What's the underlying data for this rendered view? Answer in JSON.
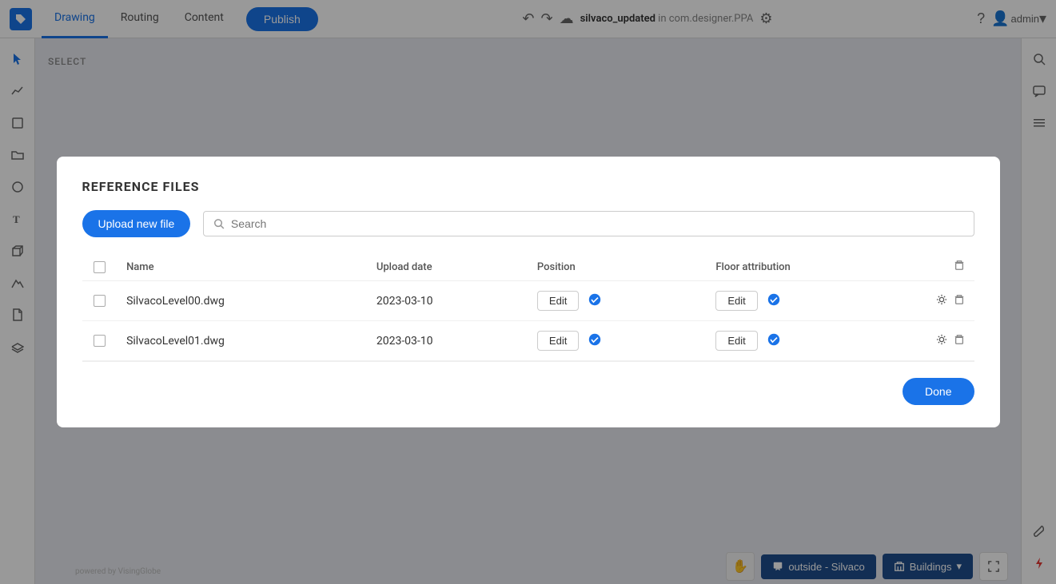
{
  "topbar": {
    "logo": "S",
    "tabs": [
      {
        "label": "Drawing",
        "active": true
      },
      {
        "label": "Routing",
        "active": false
      },
      {
        "label": "Content",
        "active": false
      }
    ],
    "publish_label": "Publish",
    "project_name": "silvaco_updated",
    "project_sub": "in com.designer.PPA",
    "user": "admin"
  },
  "modal": {
    "title": "REFERENCE FILES",
    "upload_btn": "Upload new file",
    "search_placeholder": "Search",
    "table_headers": {
      "name": "Name",
      "upload_date": "Upload date",
      "position": "Position",
      "floor_attribution": "Floor attribution"
    },
    "rows": [
      {
        "name": "SilvacoLevel00.dwg",
        "upload_date": "2023-03-10",
        "edit_label": "Edit",
        "edit_label2": "Edit"
      },
      {
        "name": "SilvacoLevel01.dwg",
        "upload_date": "2023-03-10",
        "edit_label": "Edit",
        "edit_label2": "Edit"
      }
    ],
    "done_btn": "Done"
  },
  "bottom_bar": {
    "location_label": "outside - Silvaco",
    "buildings_label": "Buildings"
  },
  "sidebar": {
    "icons": [
      "cursor",
      "trend",
      "square",
      "folder",
      "circle",
      "text",
      "cube",
      "mountain",
      "file",
      "layers"
    ]
  },
  "right_sidebar": {
    "icons": [
      "search",
      "chat",
      "list",
      "wrench",
      "lightning"
    ]
  }
}
